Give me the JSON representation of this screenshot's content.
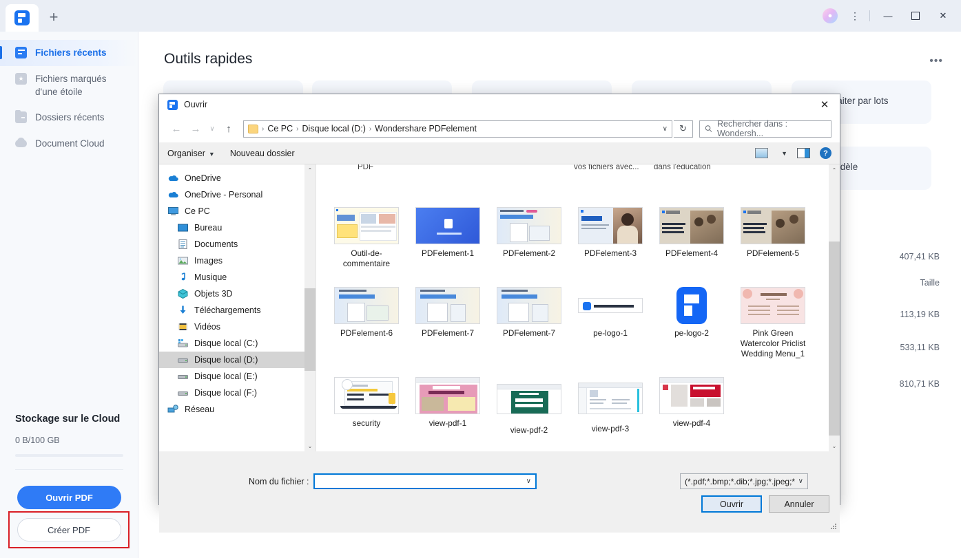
{
  "titlebar": {
    "plus_label": "+",
    "avatar_glyph": "●",
    "more_glyph": "⋮",
    "minimize_glyph": "—",
    "maximize_glyph": "",
    "close_glyph": "✕"
  },
  "sidebar": {
    "items": [
      {
        "label": "Fichiers récents",
        "icon": "recent-files-icon",
        "active": true
      },
      {
        "label": "Fichiers marqués d'une étoile",
        "icon": "starred-files-icon",
        "active": false
      },
      {
        "label": "Dossiers récents",
        "icon": "recent-folders-icon",
        "active": false
      },
      {
        "label": "Document Cloud",
        "icon": "cloud-icon",
        "active": false
      }
    ],
    "cloud_storage_title": "Stockage sur le Cloud",
    "cloud_storage_amount": "0 B/100 GB",
    "open_pdf_label": "Ouvrir PDF",
    "create_pdf_label": "Créer PDF",
    "highlight_color": "#d91f26",
    "accent_color": "#2f7bf6"
  },
  "main": {
    "page_title": "Outils rapides",
    "more_glyph": "•••",
    "cards": [
      {
        "label": ""
      },
      {
        "label": ""
      },
      {
        "label": ""
      },
      {
        "label": ""
      },
      {
        "label": "Traiter par lots"
      }
    ],
    "cards_row2": [
      {
        "label": "Modèle"
      }
    ],
    "size_column_header": "Taille",
    "sizes": [
      "407,41 KB",
      "113,19 KB",
      "533,11 KB",
      "810,71 KB"
    ]
  },
  "dialog": {
    "title": "Ouvrir",
    "close_glyph": "✕",
    "nav": {
      "back_glyph": "←",
      "forward_glyph": "→",
      "history_glyph": "∨",
      "up_glyph": "↑",
      "breadcrumb": [
        "Ce PC",
        "Disque local (D:)",
        "Wondershare PDFelement"
      ],
      "separator": "›",
      "dropdown_glyph": "∨",
      "refresh_glyph": "↻",
      "search_placeholder": "Rechercher dans : Wondersh...",
      "search_icon": "search-icon"
    },
    "commandbar": {
      "organize_label": "Organiser",
      "organize_caret": "▼",
      "new_folder_label": "Nouveau dossier",
      "view_caret": "▼",
      "help_label": "?"
    },
    "tree": [
      {
        "label": "OneDrive",
        "icon": "onedrive-icon",
        "indent": false,
        "selected": false
      },
      {
        "label": "OneDrive - Personal",
        "icon": "onedrive-icon",
        "indent": false,
        "selected": false
      },
      {
        "label": "Ce PC",
        "icon": "this-pc-icon",
        "indent": false,
        "selected": false
      },
      {
        "label": "Bureau",
        "icon": "desktop-icon",
        "indent": true,
        "selected": false
      },
      {
        "label": "Documents",
        "icon": "documents-icon",
        "indent": true,
        "selected": false
      },
      {
        "label": "Images",
        "icon": "pictures-icon",
        "indent": true,
        "selected": false
      },
      {
        "label": "Musique",
        "icon": "music-icon",
        "indent": true,
        "selected": false
      },
      {
        "label": "Objets 3D",
        "icon": "objects3d-icon",
        "indent": true,
        "selected": false
      },
      {
        "label": "Téléchargements",
        "icon": "downloads-icon",
        "indent": true,
        "selected": false
      },
      {
        "label": "Vidéos",
        "icon": "videos-icon",
        "indent": true,
        "selected": false
      },
      {
        "label": "Disque local (C:)",
        "icon": "drive-c-icon",
        "indent": true,
        "selected": false
      },
      {
        "label": "Disque local (D:)",
        "icon": "drive-d-icon",
        "indent": true,
        "selected": true
      },
      {
        "label": "Disque local (E:)",
        "icon": "drive-e-icon",
        "indent": true,
        "selected": false
      },
      {
        "label": "Disque local (F:)",
        "icon": "drive-f-icon",
        "indent": true,
        "selected": false
      },
      {
        "label": "Réseau",
        "icon": "network-icon",
        "indent": false,
        "selected": false
      }
    ],
    "clipped_row": {
      "col1": "PDF",
      "col2": "vos fichiers avec...",
      "col3": "dans l'éducation"
    },
    "files": [
      [
        {
          "name": "Outil-de-commentaire",
          "thumb": "comment-tool"
        },
        {
          "name": "PDFelement-1",
          "thumb": "pdfelement-blue"
        },
        {
          "name": "PDFelement-2",
          "thumb": "pdfelement-solution"
        },
        {
          "name": "PDFelement-3",
          "thumb": "woman-laptop"
        },
        {
          "name": "PDFelement-4",
          "thumb": "team-photo"
        },
        {
          "name": "PDFelement-5",
          "thumb": "team-photo2"
        }
      ],
      [
        {
          "name": "PDFelement-6",
          "thumb": "pdfelement-solution"
        },
        {
          "name": "PDFelement-7",
          "thumb": "pdfelement-solution"
        },
        {
          "name": "PDFelement-7",
          "thumb": "pdfelement-solution"
        },
        {
          "name": "pe-logo-1",
          "thumb": "pe-wordmark"
        },
        {
          "name": "pe-logo-2",
          "thumb": "pe-logo-big"
        },
        {
          "name": "Pink Green Watercolor Priclist Wedding Menu_1",
          "thumb": "wedding-menu"
        }
      ],
      [
        {
          "name": "security",
          "thumb": "security-doc"
        },
        {
          "name": "view-pdf-1",
          "thumb": "volcano-doc"
        },
        {
          "name": "view-pdf-2",
          "thumb": "budget-proposal"
        },
        {
          "name": "view-pdf-3",
          "thumb": "invoice-doc"
        },
        {
          "name": "view-pdf-4",
          "thumb": "meet-makers"
        }
      ]
    ],
    "footer": {
      "filename_label": "Nom du fichier :",
      "filename_value": "",
      "filename_caret": "∨",
      "filetype_value": "(*.pdf;*.bmp;*.dib;*.jpg;*.jpeg;*",
      "filetype_caret": "∨",
      "open_label": "Ouvrir",
      "cancel_label": "Annuler"
    },
    "scrollbar": {
      "up_glyph": "⌃",
      "down_glyph": "⌄"
    }
  }
}
